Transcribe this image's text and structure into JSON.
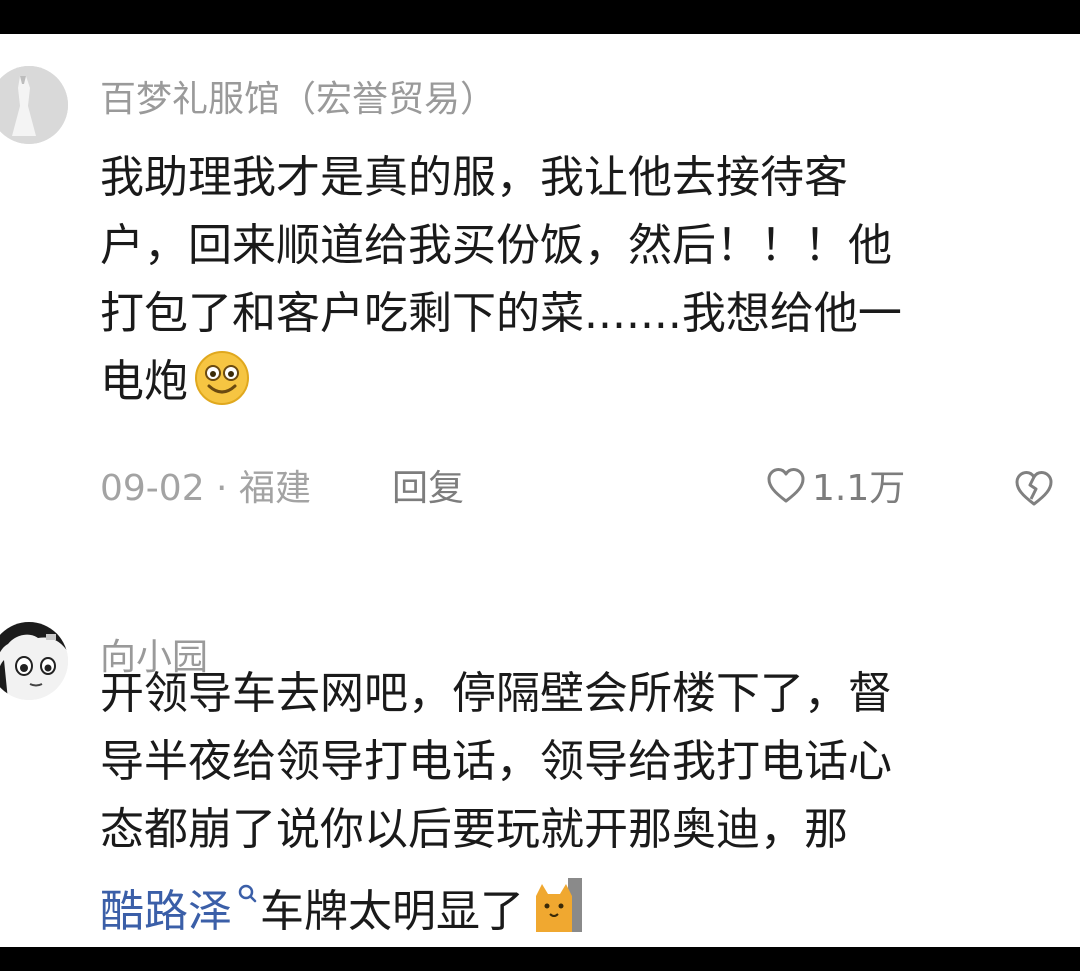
{
  "comments": [
    {
      "username": "百梦礼服馆（宏誉贸易）",
      "lines": [
        "我助理我才是真的服，我让他去接待客",
        "户，回来顺道给我买份饭，然后！！！他",
        "打包了和客户吃剩下的菜.......我想给他一",
        "电炮"
      ],
      "date_location": "09-02 · 福建",
      "reply_label": "回复",
      "like_count": "1.1万",
      "emoji": "smiling-face-icon"
    },
    {
      "username": "向小园",
      "lines": [
        "开领导车去网吧，停隔壁会所楼下了，督",
        "导半夜给领导打电话，领导给我打电话心",
        "态都崩了说你以后要玩就开那奥迪，那"
      ],
      "mention": "酷路泽",
      "last_line_rest": "车牌太明显了",
      "emoji": "cat-icon"
    }
  ],
  "colors": {
    "username": "#9a9a9a",
    "text": "#1a1a1a",
    "meta": "#a3a3a3",
    "mention": "#3b5fa8"
  }
}
